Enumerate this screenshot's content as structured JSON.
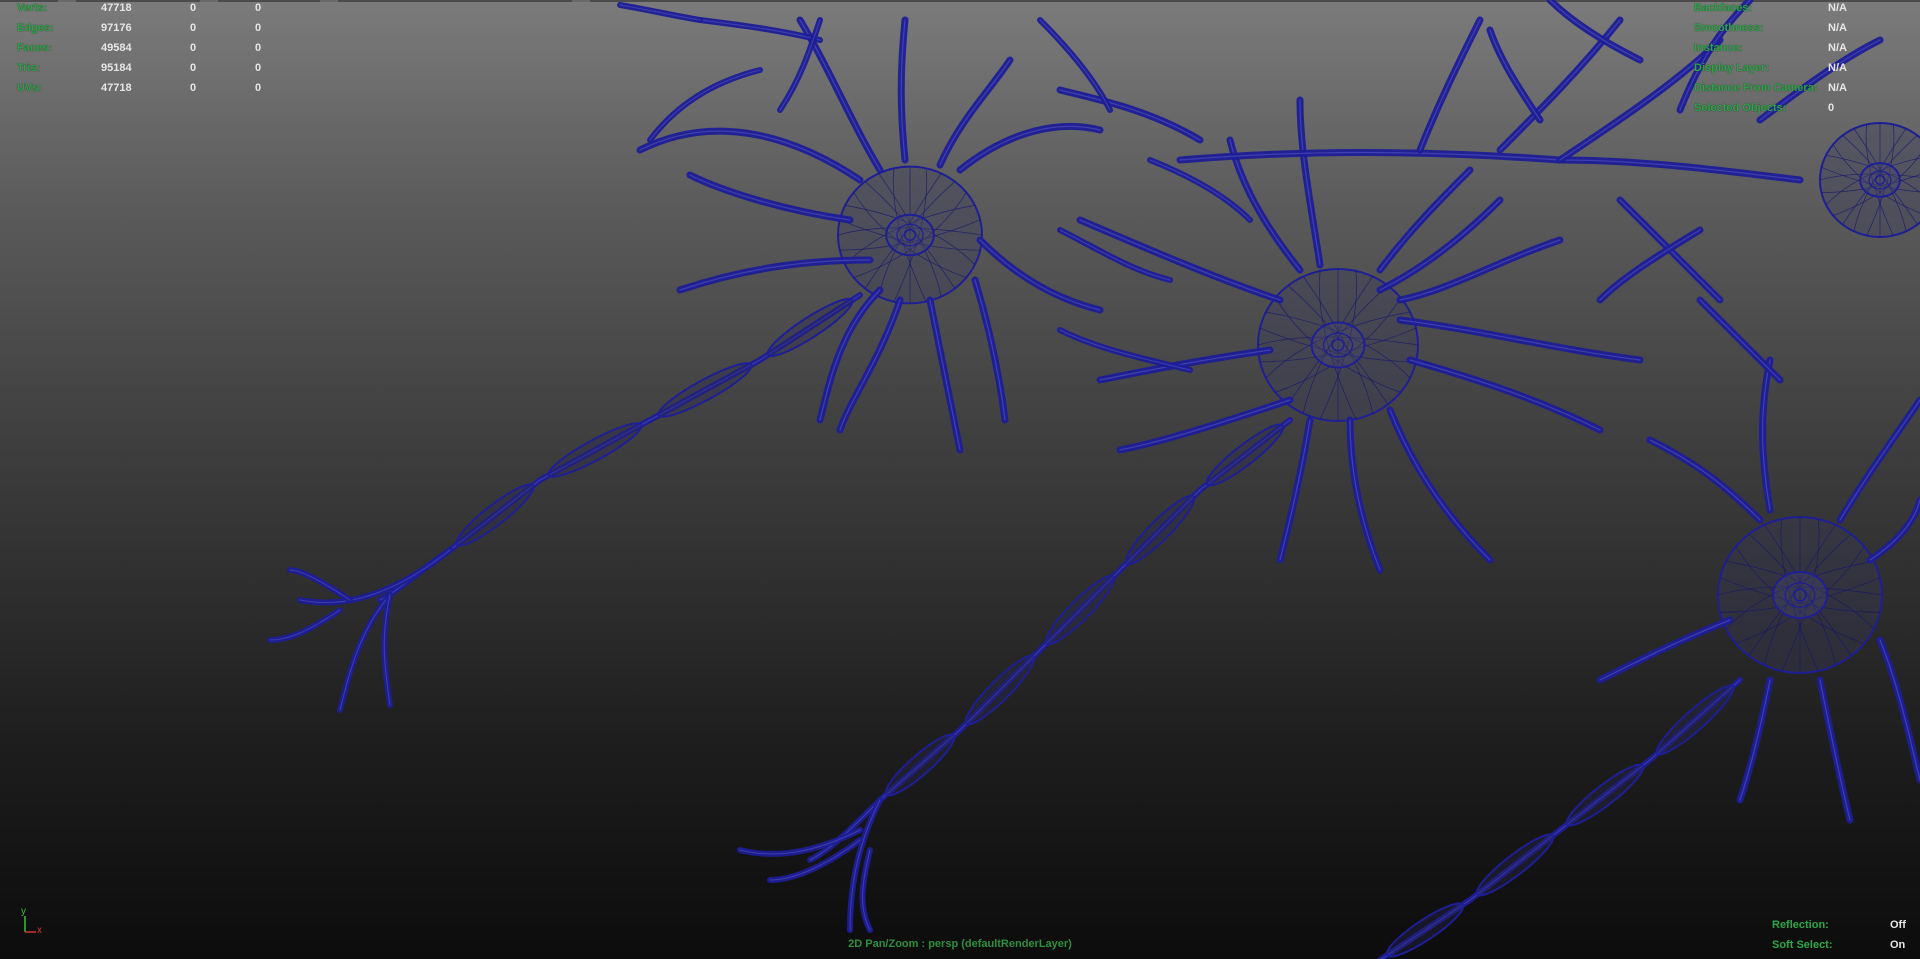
{
  "poly_count": {
    "rows": [
      {
        "label": "Verts:",
        "total": "47718",
        "selected": "0",
        "uv": "0"
      },
      {
        "label": "Edges:",
        "total": "97176",
        "selected": "0",
        "uv": "0"
      },
      {
        "label": "Faces:",
        "total": "49584",
        "selected": "0",
        "uv": "0"
      },
      {
        "label": "Tris:",
        "total": "95184",
        "selected": "0",
        "uv": "0"
      },
      {
        "label": "UVs:",
        "total": "47718",
        "selected": "0",
        "uv": "0"
      }
    ]
  },
  "display_info": {
    "rows": [
      {
        "label": "Backfaces:",
        "value": "N/A"
      },
      {
        "label": "Smoothness:",
        "value": "N/A"
      },
      {
        "label": "Instance:",
        "value": "N/A"
      },
      {
        "label": "Display Layer:",
        "value": "N/A"
      },
      {
        "label": "Distance From Camera:",
        "value": "N/A"
      },
      {
        "label": "Selected Objects:",
        "value": "0"
      }
    ]
  },
  "bottom_info": {
    "rows": [
      {
        "label": "Reflection:",
        "value": "Off"
      },
      {
        "label": "Soft Select:",
        "value": "On"
      }
    ]
  },
  "camera_label": "2D Pan/Zoom : persp (defaultRenderLayer)",
  "axis": {
    "y": "y",
    "x": "x"
  },
  "colors": {
    "wire": "#1e1e96",
    "hud_label": "#2fa34a",
    "hud_value": "#e6e6e6",
    "axis_y": "#3cbf3c",
    "axis_x": "#d23030"
  }
}
